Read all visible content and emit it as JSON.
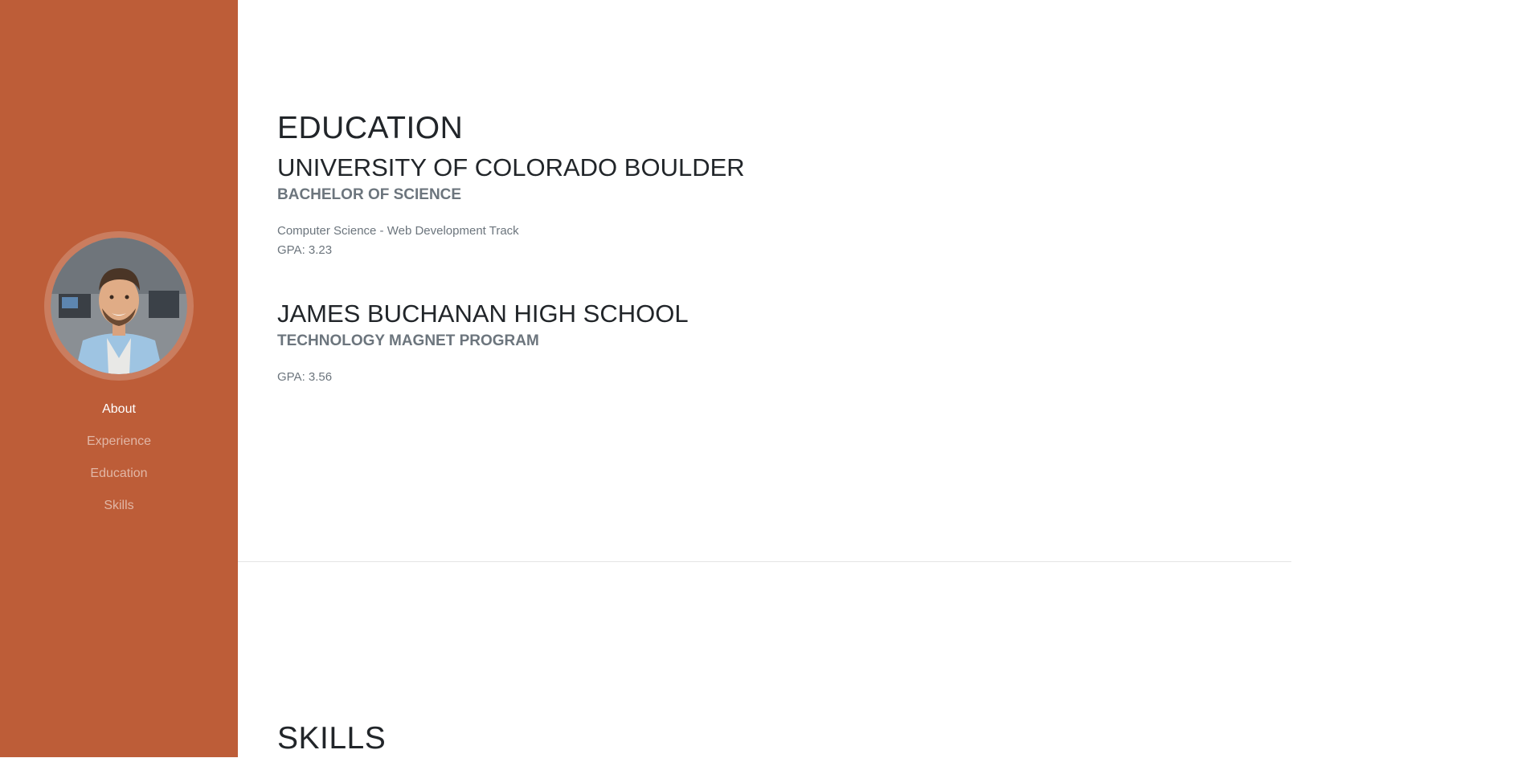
{
  "nav": {
    "items": [
      {
        "label": "About",
        "active": true
      },
      {
        "label": "Experience",
        "active": false
      },
      {
        "label": "Education",
        "active": false
      },
      {
        "label": "Skills",
        "active": false
      }
    ]
  },
  "colors": {
    "sidebar": "#bd5d38",
    "heading": "#212529",
    "muted": "#6c757d"
  },
  "education": {
    "title": "EDUCATION",
    "entries": [
      {
        "school": "UNIVERSITY OF COLORADO BOULDER",
        "degree": "BACHELOR OF SCIENCE",
        "details": [
          "Computer Science - Web Development Track",
          "GPA: 3.23"
        ]
      },
      {
        "school": "JAMES BUCHANAN HIGH SCHOOL",
        "degree": "TECHNOLOGY MAGNET PROGRAM",
        "details": [
          "GPA: 3.56"
        ]
      }
    ]
  },
  "skills": {
    "title": "SKILLS"
  }
}
